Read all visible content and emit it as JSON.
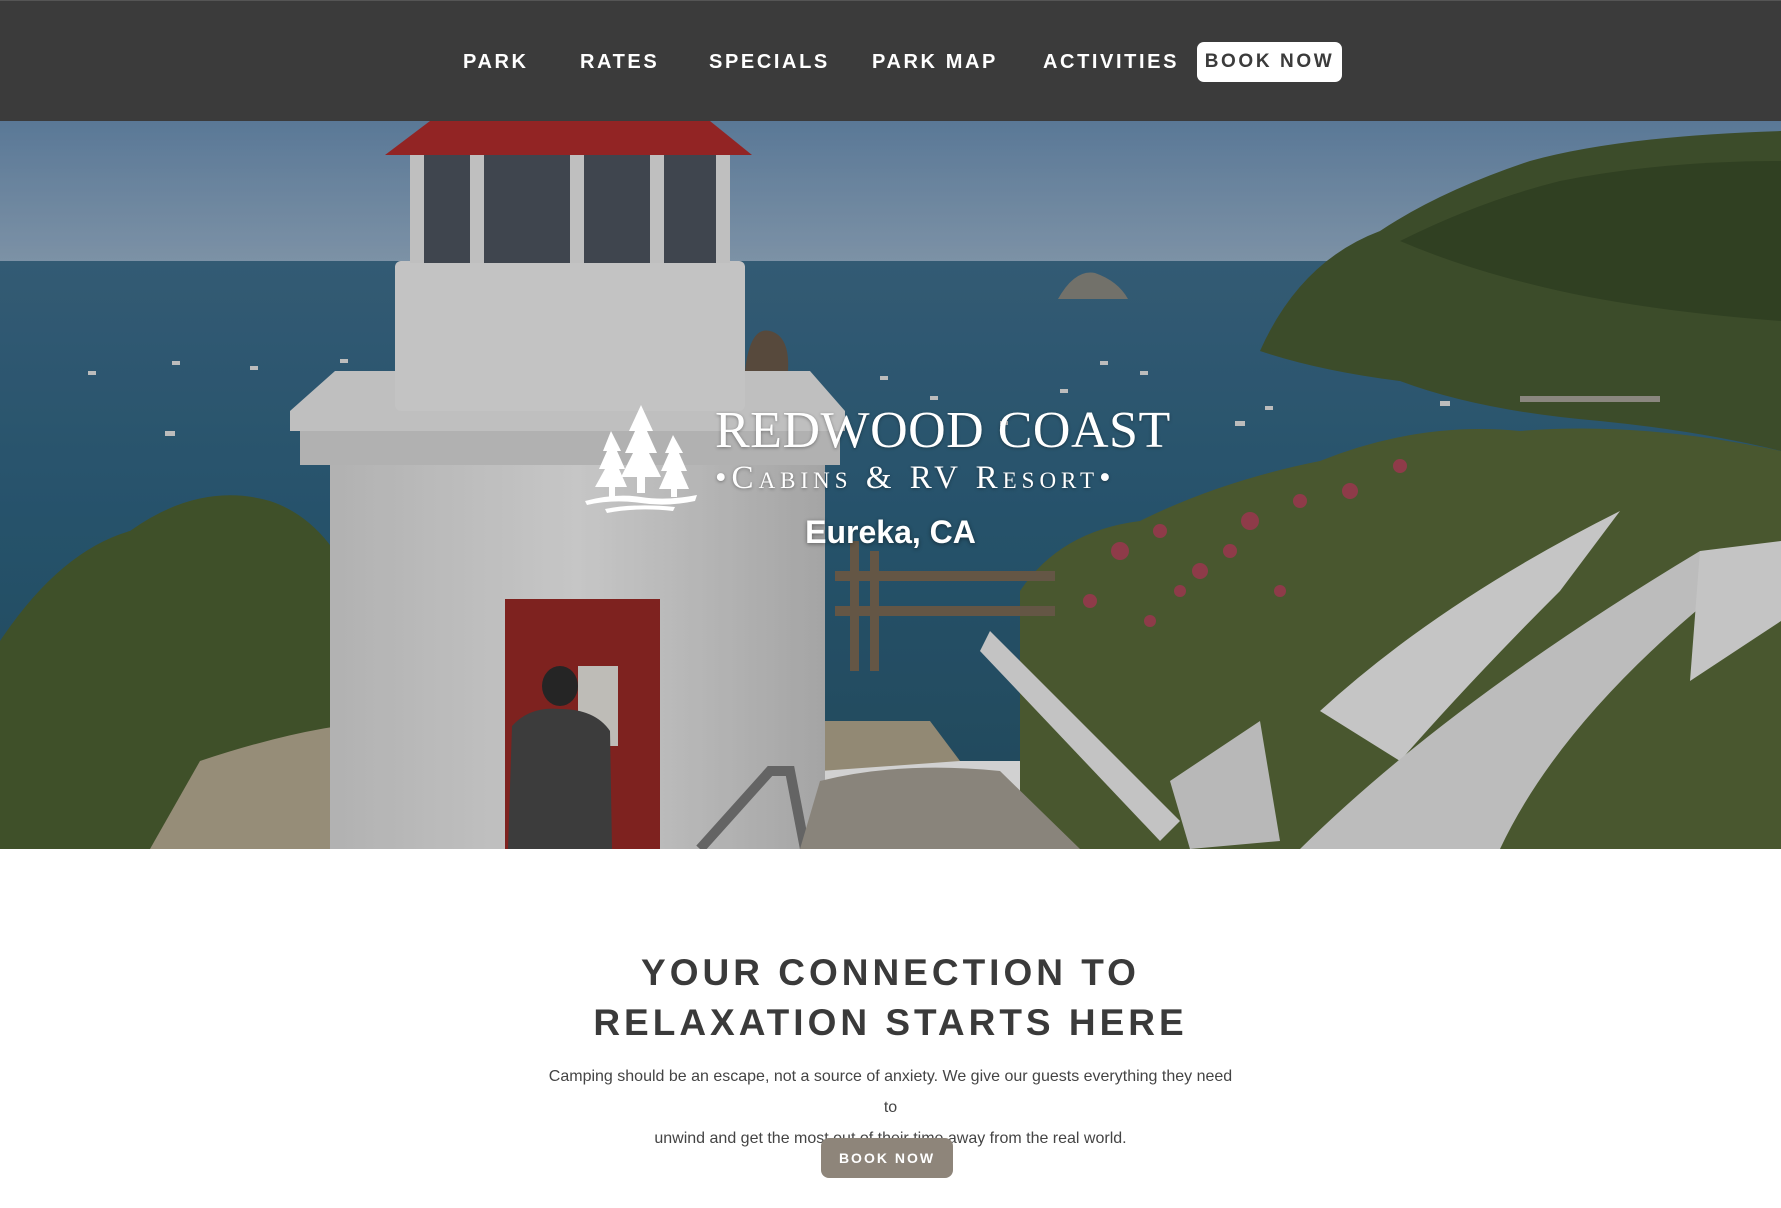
{
  "nav": {
    "items": [
      {
        "label": "PARK"
      },
      {
        "label": "RATES"
      },
      {
        "label": "SPECIALS"
      },
      {
        "label": "PARK MAP"
      },
      {
        "label": "ACTIVITIES"
      }
    ],
    "book_label": "BOOK NOW"
  },
  "hero": {
    "brand_line1": "REDWOOD COAST",
    "brand_line2": "•Cabins & RV Resort•",
    "location": "Eureka, CA"
  },
  "intro": {
    "headline_line1": "YOUR CONNECTION TO",
    "headline_line2": "RELAXATION STARTS HERE",
    "description_line1": "Camping should be an escape, not a source of anxiety. We give our guests everything they need to",
    "description_line2": "unwind and get the most out of their time away from the real world.",
    "cta_label": "BOOK NOW"
  },
  "colors": {
    "nav_bg": "#3b3b3b",
    "cta_bg": "#8e857a",
    "text_dark": "#3a3a3a"
  }
}
